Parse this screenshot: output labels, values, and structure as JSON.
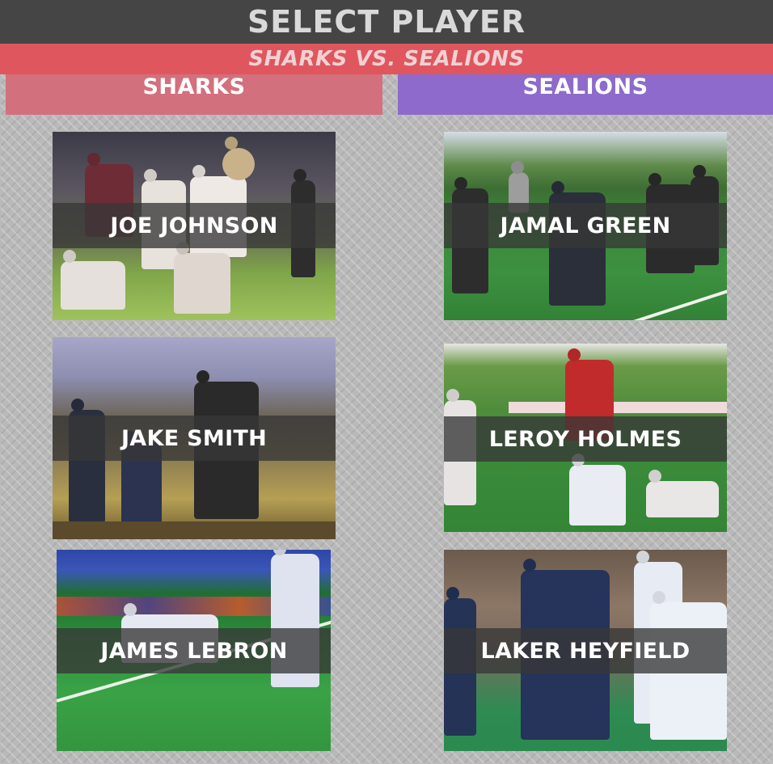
{
  "header": {
    "title": "SELECT PLAYER",
    "matchup": "SHARKS VS. SEALIONS"
  },
  "teams": {
    "left": {
      "name": "SHARKS",
      "color": "#d3707d"
    },
    "right": {
      "name": "SEALIONS",
      "color": "#8d6acc"
    }
  },
  "players": {
    "left": [
      {
        "name": "JOE JOHNSON"
      },
      {
        "name": "JAKE SMITH"
      },
      {
        "name": "JAMES LEBRON"
      }
    ],
    "right": [
      {
        "name": "JAMAL GREEN"
      },
      {
        "name": "LEROY HOLMES"
      },
      {
        "name": "LAKER HEYFIELD"
      }
    ]
  },
  "colors": {
    "topbar": "#454545",
    "matchbar": "#e0565e",
    "background": "#b9b9b9"
  }
}
